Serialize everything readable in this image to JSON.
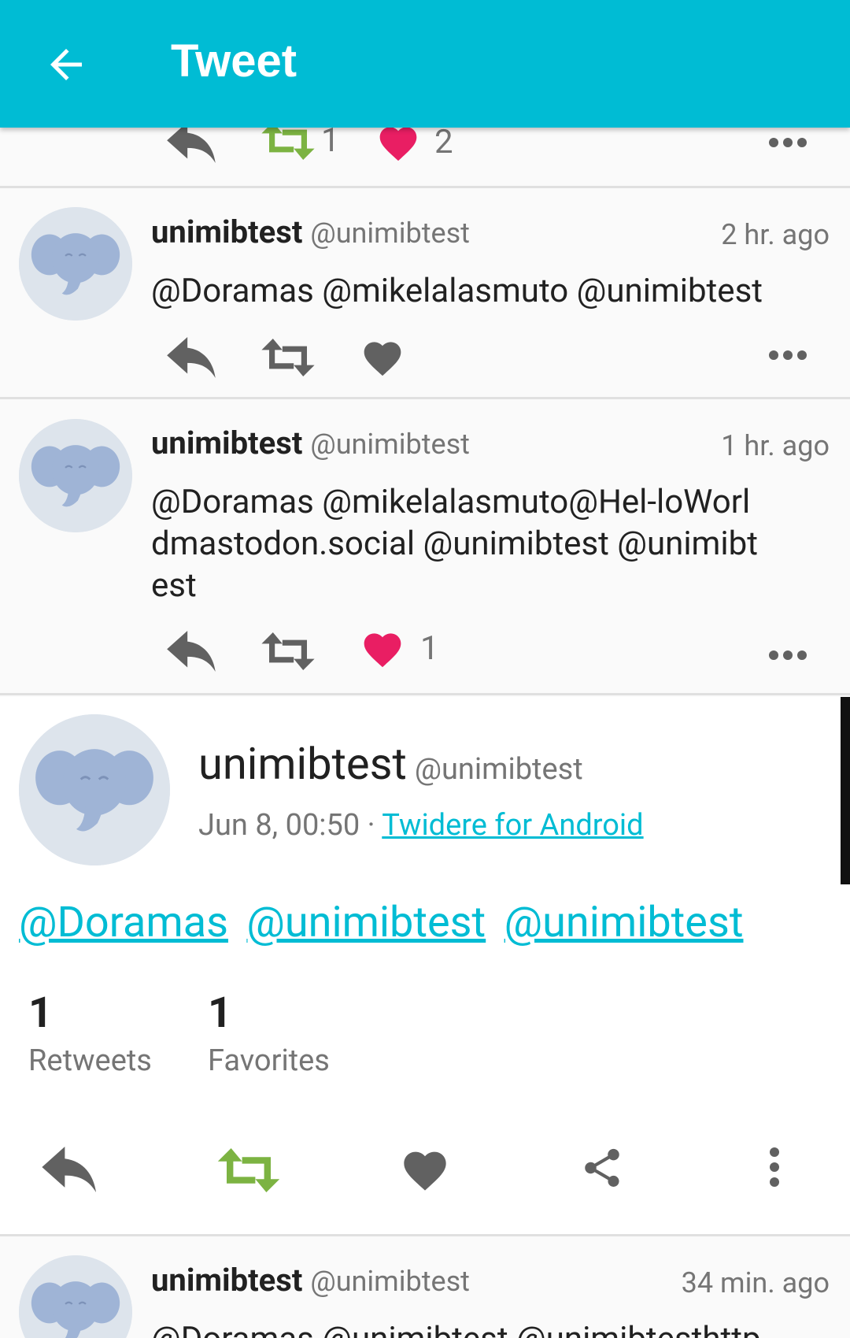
{
  "appbar": {
    "title": "Tweet"
  },
  "top_partial": {
    "retweets": "1",
    "favorites": "2"
  },
  "tweets": [
    {
      "name": "unimibtest",
      "handle": "@unimibtest",
      "time": "2 hr. ago",
      "text": "@Doramas @mikelalasmuto @unimibtest"
    },
    {
      "name": "unimibtest",
      "handle": "@unimibtest",
      "time": "1 hr. ago",
      "text": "@Doramas @mikelalasmuto@Hel-loWorldmastodon.social @unimibtest @unimibtest",
      "favorites": "1"
    }
  ],
  "main": {
    "name": "unimibtest",
    "handle": "@unimibtest",
    "date": "Jun 8, 00:50 · ",
    "source": "Twidere for Android",
    "mentions": [
      "@Doramas",
      "@unimibtest",
      "@unimibtest"
    ],
    "retweets_count": "1",
    "retweets_label": "Retweets",
    "favorites_count": "1",
    "favorites_label": "Favorites"
  },
  "bottom_tweet": {
    "name": "unimibtest",
    "handle": "@unimibtest",
    "time": "34 min. ago",
    "text": "@Doramas @unimibtest @unimibtesthttp"
  },
  "colors": {
    "accent": "#00bcd4",
    "retweet_active": "#7cb342",
    "heart_active": "#e91e63",
    "icon": "#616161"
  }
}
